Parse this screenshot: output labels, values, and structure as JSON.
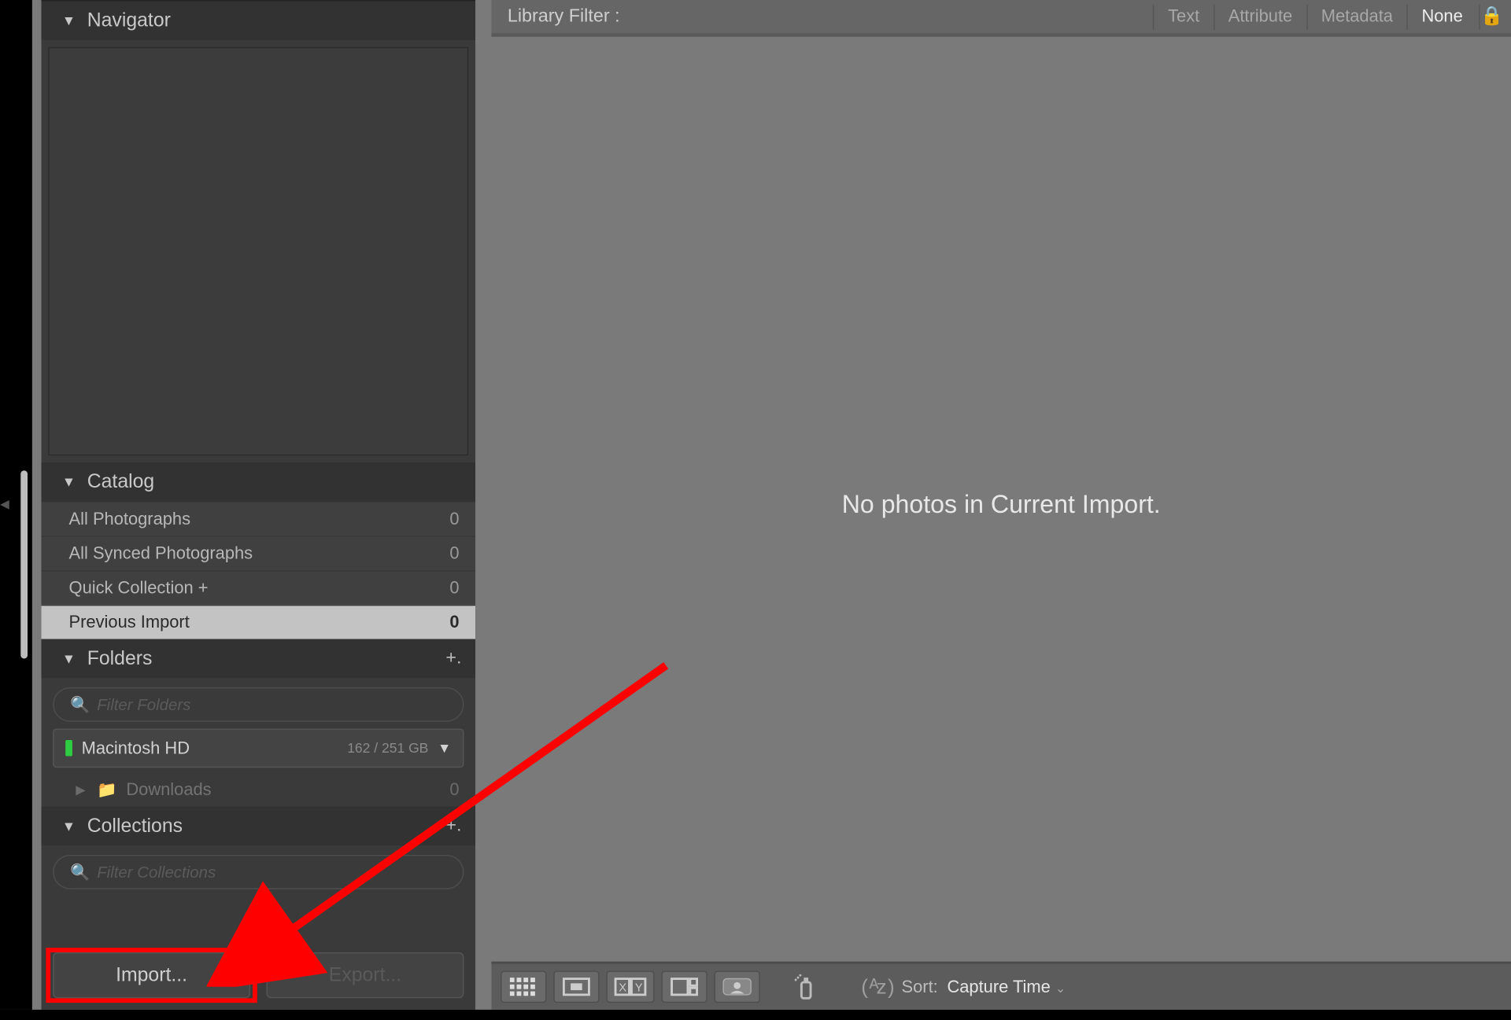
{
  "navigator": {
    "title": "Navigator",
    "meta": ""
  },
  "catalog": {
    "title": "Catalog",
    "items": [
      {
        "label": "All Photographs",
        "count": "0"
      },
      {
        "label": "All Synced Photographs",
        "count": "0"
      },
      {
        "label": "Quick Collection  +",
        "count": "0"
      },
      {
        "label": "Previous Import",
        "count": "0"
      }
    ]
  },
  "folders": {
    "title": "Folders",
    "filter_placeholder": "Filter Folders",
    "volume": {
      "name": "Macintosh HD",
      "capacity": "162 / 251 GB"
    },
    "children": [
      {
        "label": "Downloads",
        "count": "0"
      }
    ]
  },
  "collections": {
    "title": "Collections",
    "filter_placeholder": "Filter Collections"
  },
  "buttons": {
    "import": "Import...",
    "export": "Export..."
  },
  "filter_bar": {
    "label": "Library Filter :",
    "tabs": [
      "Text",
      "Attribute",
      "Metadata",
      "None"
    ],
    "active": "None"
  },
  "main": {
    "empty_message": "No photos in Current Import."
  },
  "toolbar": {
    "sort_label": "Sort:",
    "sort_value": "Capture Time"
  }
}
